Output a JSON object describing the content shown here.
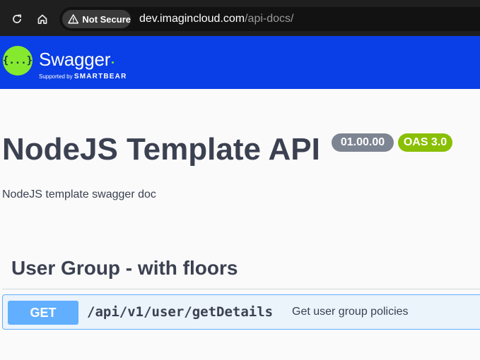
{
  "browser": {
    "security_label": "Not Secure",
    "url_host": "dev.imagincloud.com",
    "url_path": "/api-docs/"
  },
  "swagger_bar": {
    "brand": "Swagger",
    "supported_by": "Supported by",
    "smartbear": "SMARTBEAR",
    "logo_glyph": "{...}",
    "bar_color": "#0a3ee6",
    "logo_color": "#85ea2d"
  },
  "info": {
    "title": "NodeJS Template API",
    "version": "01.00.00",
    "oas": "OAS 3.0",
    "description": "NodeJS template swagger doc"
  },
  "tags": [
    {
      "name": "User Group - with floors",
      "operations": [
        {
          "method": "GET",
          "path": "/api/v1/user/getDetails",
          "summary": "Get user group policies",
          "color": "#61affe"
        }
      ]
    }
  ],
  "icons": [
    "reload-icon",
    "home-icon",
    "warning-icon",
    "swagger-logo"
  ]
}
